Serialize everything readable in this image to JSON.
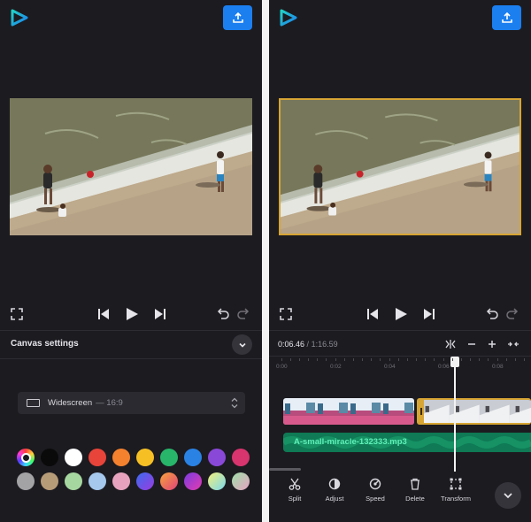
{
  "colors": {
    "bg": "#1c1b20",
    "accent": "#1b7ff0",
    "selection": "#d7a534",
    "audio_track": "#0f7a55",
    "audio_text": "#5ff0b8"
  },
  "icons": {
    "logo": "play-triangle-logo",
    "export": "upload-icon",
    "fullscreen": "fullscreen-icon",
    "prev": "skip-previous-icon",
    "play": "play-icon",
    "next": "skip-next-icon",
    "undo": "undo-icon",
    "redo": "redo-icon"
  },
  "left": {
    "canvas_title": "Canvas settings",
    "aspect": {
      "name": "Widescreen",
      "ratio": "— 16:9"
    },
    "swatches_row1": [
      "color-wheel",
      "#0a0a0a",
      "#ffffff",
      "#e8443a",
      "#f4812e",
      "#f6c025",
      "#27b66a",
      "#2a82e4",
      "#8a48d8",
      "#d8346e"
    ],
    "swatches_row2": [
      "#a3a3a6",
      "#b79c78",
      "#a6d7a0",
      "#a5c8ec",
      "#e7a3bd",
      "gradient-blue-purple",
      "gradient-orange-pink",
      "gradient-purple-pink",
      "gradient-yellow-cyan",
      "gradient-green-pink"
    ]
  },
  "right": {
    "time_current": "0:06.46",
    "time_separator": "/",
    "time_total": "1:16.59",
    "ruler": [
      "0:00",
      "0:02",
      "0:04",
      "0:06",
      "0:08"
    ],
    "audio_track": "A-small-miracle-132333.mp3",
    "tools": [
      {
        "label": "Split",
        "icon": "scissors-icon"
      },
      {
        "label": "Adjust",
        "icon": "adjust-icon"
      },
      {
        "label": "Speed",
        "icon": "speed-icon"
      },
      {
        "label": "Delete",
        "icon": "trash-icon"
      },
      {
        "label": "Transform",
        "icon": "transform-icon"
      }
    ]
  }
}
